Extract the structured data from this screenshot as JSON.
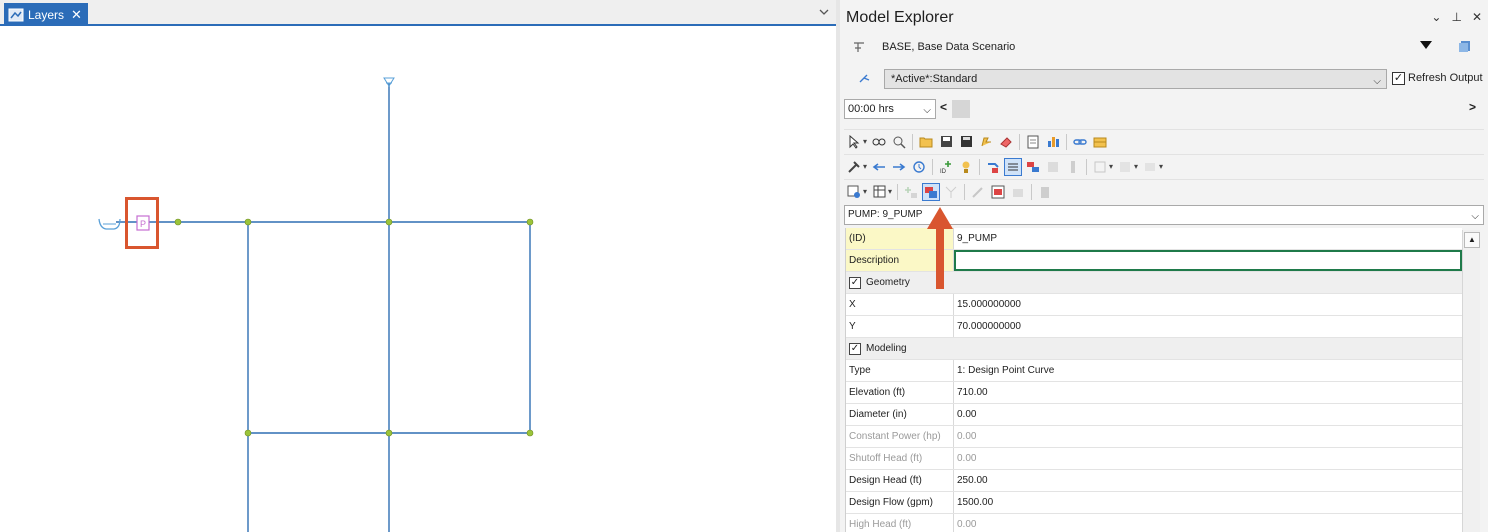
{
  "left_tab": {
    "label": "Layers",
    "close": "✕"
  },
  "panel": {
    "title": "Model Explorer",
    "controls": {
      "menu": "⌄",
      "pin": "⊥",
      "close": "✕"
    },
    "scenario": "BASE, Base Data Scenario",
    "profile": "*Active*:Standard",
    "refresh_label": "Refresh Output",
    "refresh_checked": "✓",
    "time": "00:00 hrs",
    "element": "PUMP: 9_PUMP"
  },
  "properties": [
    {
      "name": "(ID)",
      "value": "9_PUMP",
      "kind": "hl"
    },
    {
      "name": "Description",
      "value": "",
      "kind": "hl-edit"
    },
    {
      "name": "Geometry",
      "value": "",
      "kind": "cat"
    },
    {
      "name": "X",
      "value": "15.000000000",
      "kind": ""
    },
    {
      "name": "Y",
      "value": "70.000000000",
      "kind": ""
    },
    {
      "name": "Modeling",
      "value": "",
      "kind": "cat"
    },
    {
      "name": "Type",
      "value": "1: Design Point Curve",
      "kind": ""
    },
    {
      "name": "Elevation (ft)",
      "value": "710.00",
      "kind": ""
    },
    {
      "name": "Diameter (in)",
      "value": "0.00",
      "kind": ""
    },
    {
      "name": "Constant Power (hp)",
      "value": "0.00",
      "kind": "dim"
    },
    {
      "name": "Shutoff Head (ft)",
      "value": "0.00",
      "kind": "dim"
    },
    {
      "name": "Design Head (ft)",
      "value": "250.00",
      "kind": ""
    },
    {
      "name": "Design Flow (gpm)",
      "value": "1500.00",
      "kind": ""
    },
    {
      "name": "High Head (ft)",
      "value": "0.00",
      "kind": "dim"
    }
  ],
  "colors": {
    "accent": "#2b6cb8",
    "pipe": "#2f6fb3",
    "node": "#9bc43a",
    "callout": "#d9562f",
    "pump": "#c66fd1"
  },
  "icons": [
    "layers-icon",
    "scenario-icon",
    "profile-icon",
    "select-tool-icon",
    "find-icon",
    "zoom-icon",
    "open-icon",
    "save-icon",
    "sync-icon",
    "eraser-icon",
    "report-icon",
    "graph-icon",
    "link-icon",
    "table-icon",
    "pump-callout-arrow"
  ]
}
